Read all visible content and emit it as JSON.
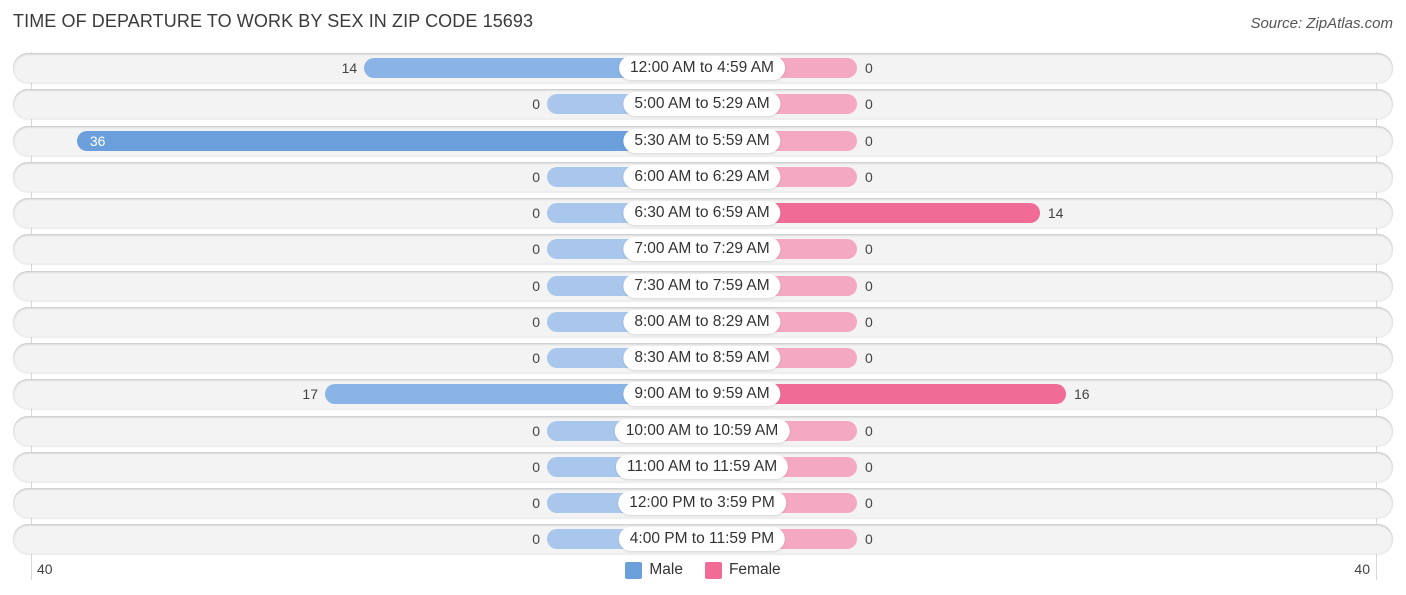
{
  "header": {
    "title": "TIME OF DEPARTURE TO WORK BY SEX IN ZIP CODE 15693",
    "source": "Source: ZipAtlas.com"
  },
  "colors": {
    "male": "#6b9fdb",
    "male_light": "#a9c7ec",
    "female": "#f06b95",
    "female_light": "#f5a8c1"
  },
  "chart_data": {
    "type": "bar",
    "orientation": "horizontal-diverging",
    "title": "TIME OF DEPARTURE TO WORK BY SEX IN ZIP CODE 15693",
    "categories": [
      "12:00 AM to 4:59 AM",
      "5:00 AM to 5:29 AM",
      "5:30 AM to 5:59 AM",
      "6:00 AM to 6:29 AM",
      "6:30 AM to 6:59 AM",
      "7:00 AM to 7:29 AM",
      "7:30 AM to 7:59 AM",
      "8:00 AM to 8:29 AM",
      "8:30 AM to 8:59 AM",
      "9:00 AM to 9:59 AM",
      "10:00 AM to 10:59 AM",
      "11:00 AM to 11:59 AM",
      "12:00 PM to 3:59 PM",
      "4:00 PM to 11:59 PM"
    ],
    "series": [
      {
        "name": "Male",
        "side": "left",
        "values": [
          14,
          0,
          36,
          0,
          0,
          0,
          0,
          0,
          0,
          17,
          0,
          0,
          0,
          0
        ]
      },
      {
        "name": "Female",
        "side": "right",
        "values": [
          0,
          0,
          0,
          0,
          14,
          0,
          0,
          0,
          0,
          16,
          0,
          0,
          0,
          0
        ]
      }
    ],
    "axis": {
      "left_tick": "40",
      "right_tick": "40",
      "range": [
        0,
        40
      ]
    },
    "legend": {
      "position": "bottom-center",
      "entries": [
        "Male",
        "Female"
      ]
    },
    "grid": false
  }
}
